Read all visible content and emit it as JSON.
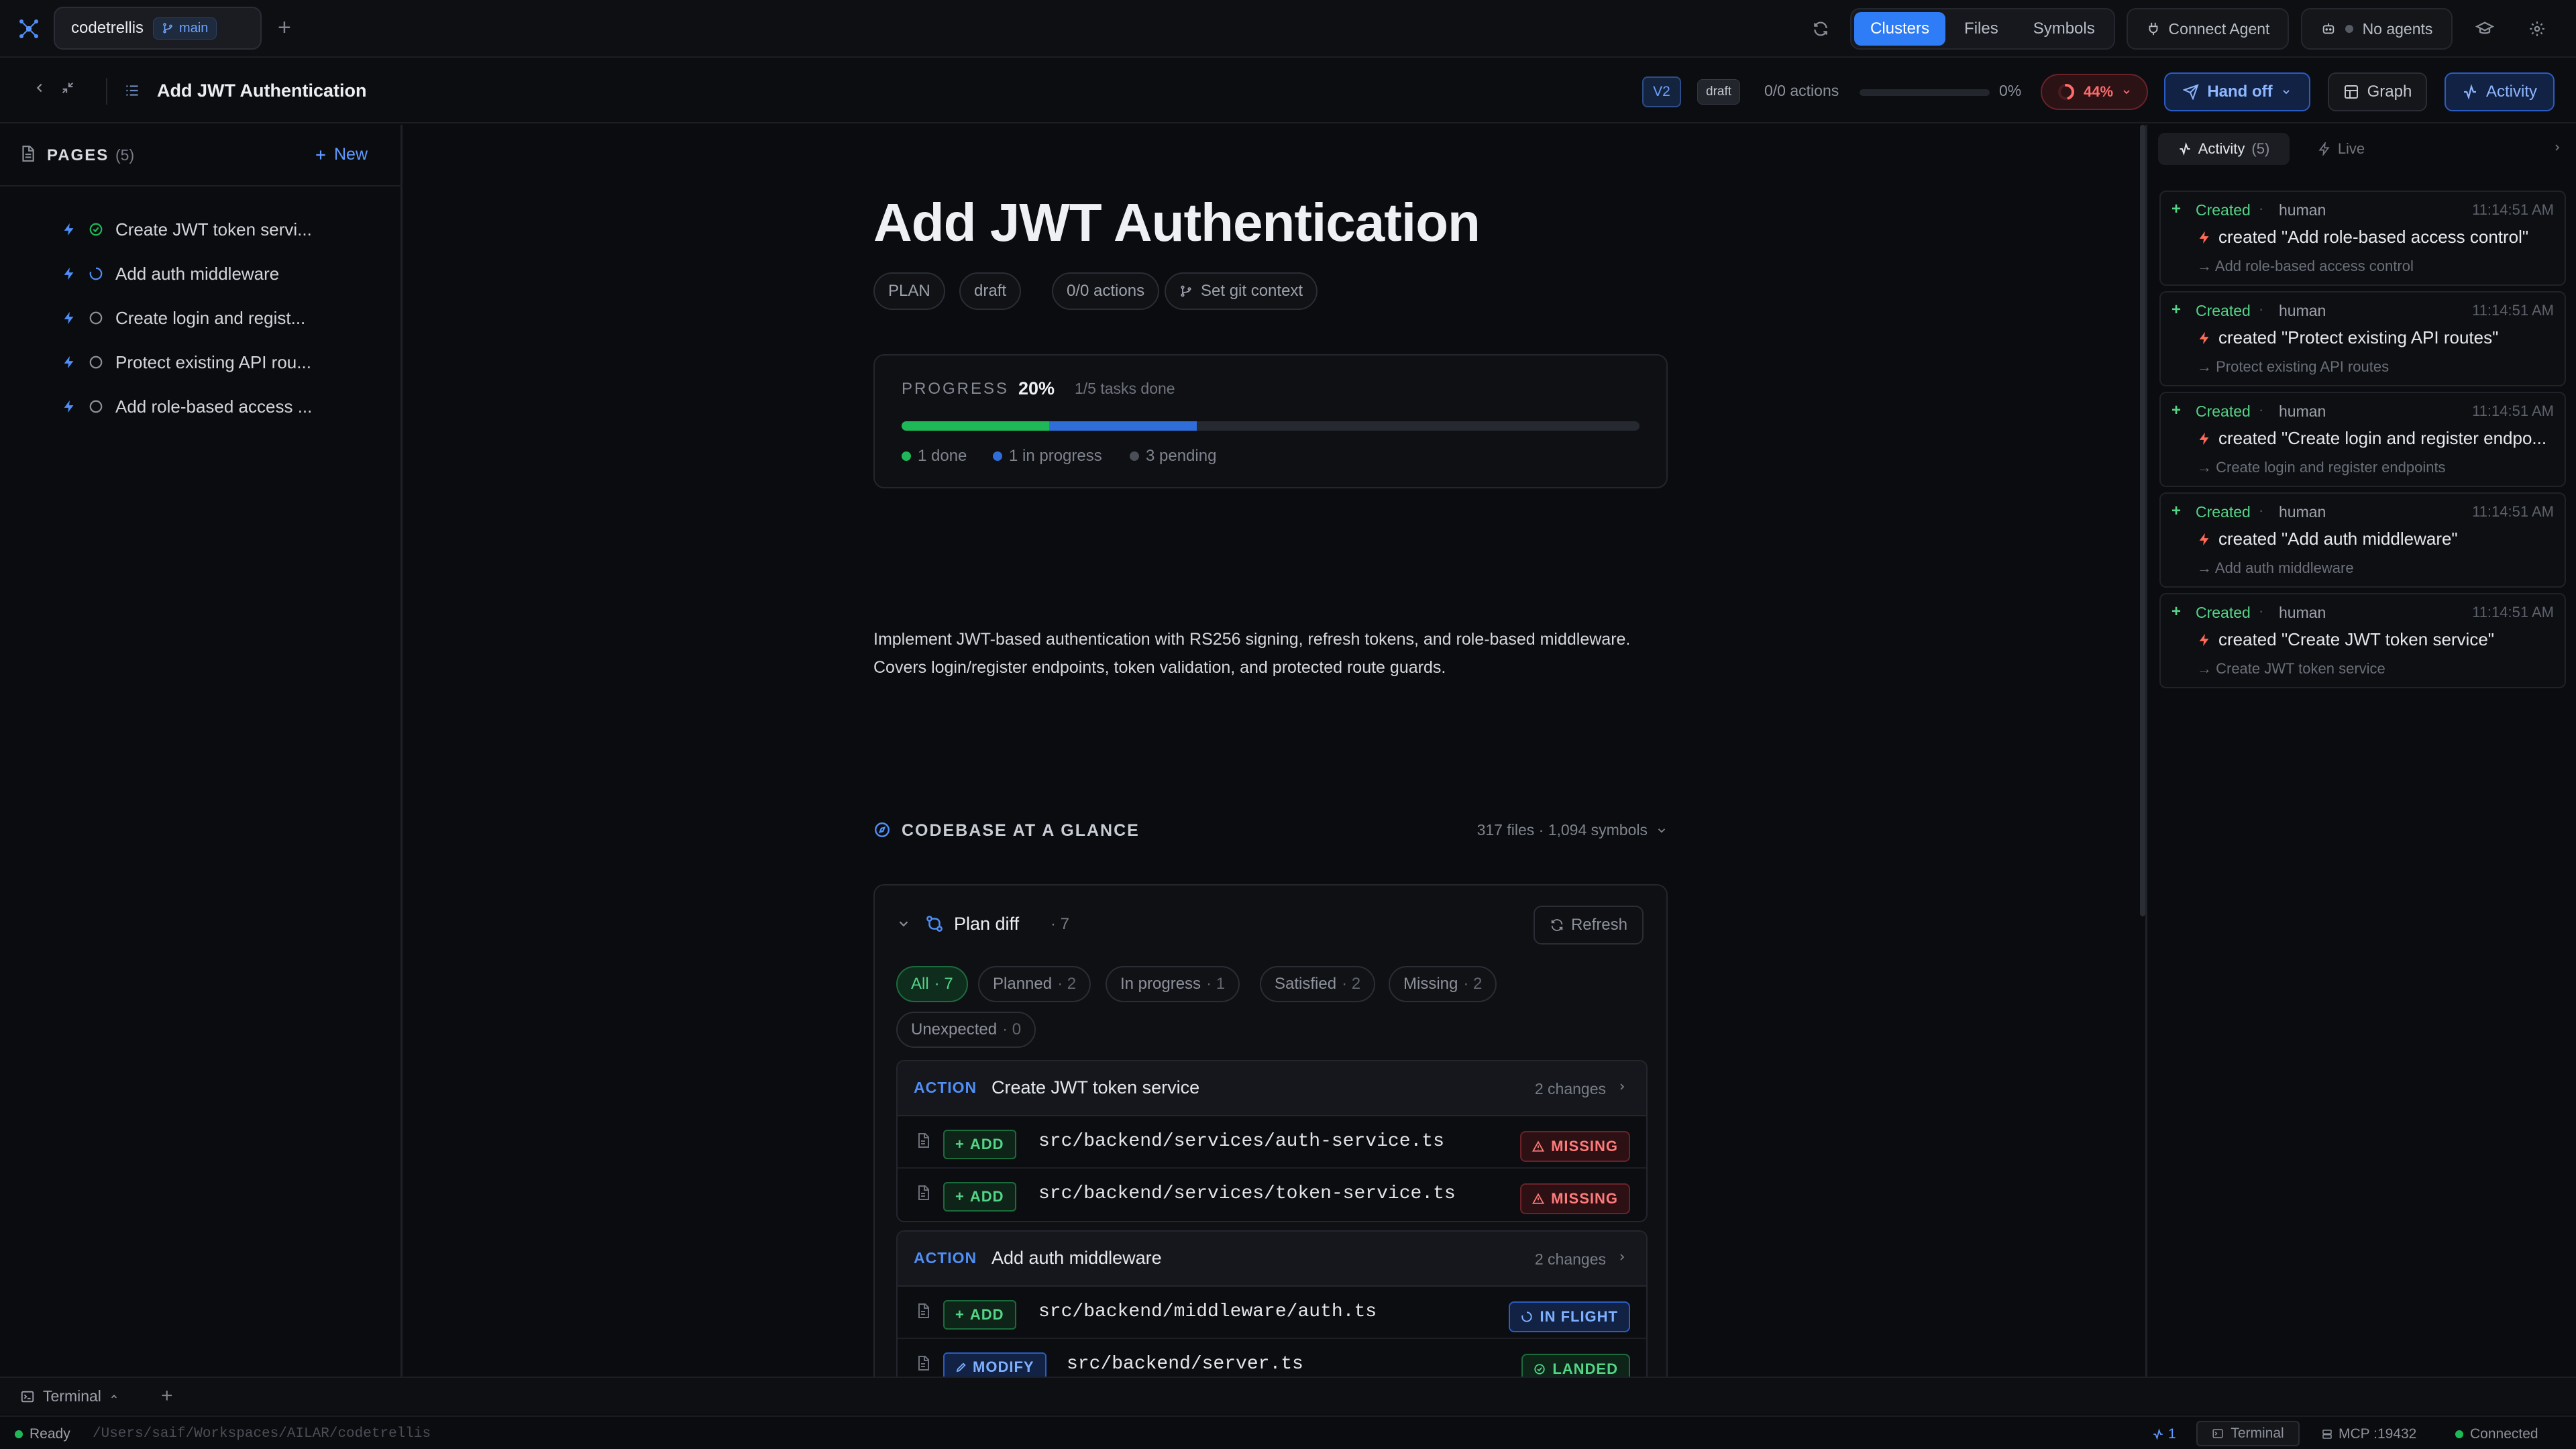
{
  "topbar": {
    "repo_name": "codetrellis",
    "branch": "main",
    "add_tab": "+",
    "views": [
      "Clusters",
      "Files",
      "Symbols"
    ],
    "active_view": "Clusters",
    "connect_agent": "Connect Agent",
    "no_agents": "No agents"
  },
  "subbar": {
    "title": "Add JWT Authentication",
    "version": "V2",
    "status": "draft",
    "actions_count": "0/0 actions",
    "actions_progress": 0,
    "actions_pct": "0%",
    "overall_progress": "44%",
    "overall_progress_value": 0.44,
    "handoff": "Hand off",
    "graph": "Graph",
    "activity": "Activity"
  },
  "sidebar": {
    "title": "PAGES",
    "count": "(5)",
    "new_label": "New",
    "pages": [
      {
        "label": "Create JWT token servi...",
        "status": "done"
      },
      {
        "label": "Add auth middleware",
        "status": "in-progress"
      },
      {
        "label": "Create login and regist...",
        "status": "pending"
      },
      {
        "label": "Protect existing API rou...",
        "status": "pending"
      },
      {
        "label": "Add role-based access ...",
        "status": "pending"
      }
    ]
  },
  "main": {
    "heading": "Add JWT Authentication",
    "chips": [
      "PLAN",
      "draft",
      "0/0 actions",
      "Set git context"
    ],
    "progress": {
      "label": "PROGRESS",
      "pct": "20%",
      "tasks": "1/5 tasks done",
      "done_fraction": 0.2,
      "inprogress_fraction": 0.2,
      "legend_done": "1 done",
      "legend_inprogress": "1 in progress",
      "legend_pending": "3 pending"
    },
    "description": "Implement JWT-based authentication with RS256 signing, refresh tokens, and role-based middleware. Covers login/register endpoints, token validation, and protected route guards.",
    "glance": {
      "label": "CODEBASE AT A GLANCE",
      "stats": "317 files · 1,094 symbols"
    },
    "plan_diff": {
      "title": "Plan diff",
      "count": "· 7",
      "refresh": "Refresh",
      "filters": [
        {
          "label": "All",
          "n": "· 7",
          "active": true
        },
        {
          "label": "Planned",
          "n": "· 2"
        },
        {
          "label": "In progress",
          "n": "· 1"
        },
        {
          "label": "Satisfied",
          "n": "· 2"
        },
        {
          "label": "Missing",
          "n": "· 2"
        },
        {
          "label": "Unexpected",
          "n": "· 0"
        }
      ],
      "actions": [
        {
          "tag": "ACTION",
          "name": "Create JWT token service",
          "changes": "2 changes",
          "files": [
            {
              "op": "ADD",
              "path": "src/backend/services/auth-service.ts",
              "status": "MISSING"
            },
            {
              "op": "ADD",
              "path": "src/backend/services/token-service.ts",
              "status": "MISSING"
            }
          ]
        },
        {
          "tag": "ACTION",
          "name": "Add auth middleware",
          "changes": "2 changes",
          "files": [
            {
              "op": "ADD",
              "path": "src/backend/middleware/auth.ts",
              "status": "IN FLIGHT"
            },
            {
              "op": "MODIFY",
              "path": "src/backend/server.ts",
              "status": "LANDED"
            }
          ]
        }
      ]
    }
  },
  "right_panel": {
    "activity_tab": "Activity",
    "activity_count": "(5)",
    "live_tab": "Live",
    "feed": [
      {
        "kind": "Created",
        "who": "human",
        "time": "11:14:51 AM",
        "msg": "created \"Add role-based access control\"",
        "sub": "→ Add role-based access control"
      },
      {
        "kind": "Created",
        "who": "human",
        "time": "11:14:51 AM",
        "msg": "created \"Protect existing API routes\"",
        "sub": "→ Protect existing API routes"
      },
      {
        "kind": "Created",
        "who": "human",
        "time": "11:14:51 AM",
        "msg": "created \"Create login and register endpo...",
        "sub": "→ Create login and register endpoints"
      },
      {
        "kind": "Created",
        "who": "human",
        "time": "11:14:51 AM",
        "msg": "created \"Add auth middleware\"",
        "sub": "→ Add auth middleware"
      },
      {
        "kind": "Created",
        "who": "human",
        "time": "11:14:51 AM",
        "msg": "created \"Create JWT token service\"",
        "sub": "→ Create JWT token service"
      }
    ]
  },
  "terminal": {
    "label": "Terminal",
    "add": "+"
  },
  "statusbar": {
    "ready": "Ready",
    "path": "/Users/saif/Workspaces/AILAR/codetrellis",
    "branch_count": "1",
    "terminal": "Terminal",
    "mcp": "MCP :19432",
    "connection": "Connected"
  },
  "colors": {
    "accent": "#2f7df6",
    "success": "#1fb859",
    "danger": "#ff6b6b",
    "background": "#0b0c0f"
  }
}
